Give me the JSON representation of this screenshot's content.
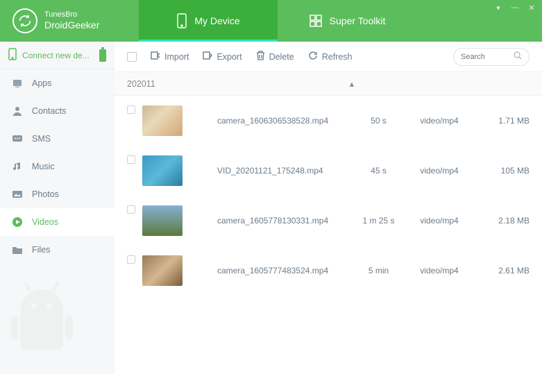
{
  "app": {
    "brand_line1": "TunesBro",
    "brand_line2": "DroidGeeker"
  },
  "tabs": {
    "my_device": "My Device",
    "super_toolkit": "Super Toolkit"
  },
  "sidebar": {
    "connect_label": "Connect new de...",
    "items": [
      {
        "label": "Apps"
      },
      {
        "label": "Contacts"
      },
      {
        "label": "SMS"
      },
      {
        "label": "Music"
      },
      {
        "label": "Photos"
      },
      {
        "label": "Videos"
      },
      {
        "label": "Files"
      }
    ]
  },
  "toolbar": {
    "import": "Import",
    "export": "Export",
    "delete": "Delete",
    "refresh": "Refresh",
    "search_placeholder": "Search"
  },
  "group": {
    "name": "202011"
  },
  "rows": [
    {
      "filename": "camera_1606306538528.mp4",
      "duration": "50 s",
      "mime": "video/mp4",
      "size": "1.71 MB"
    },
    {
      "filename": "VID_20201121_175248.mp4",
      "duration": "45 s",
      "mime": "video/mp4",
      "size": "105 MB"
    },
    {
      "filename": "camera_1605778130331.mp4",
      "duration": "1 m 25 s",
      "mime": "video/mp4",
      "size": "2.18 MB"
    },
    {
      "filename": "camera_1605777483524.mp4",
      "duration": "5 min",
      "mime": "video/mp4",
      "size": "2.61 MB"
    }
  ]
}
